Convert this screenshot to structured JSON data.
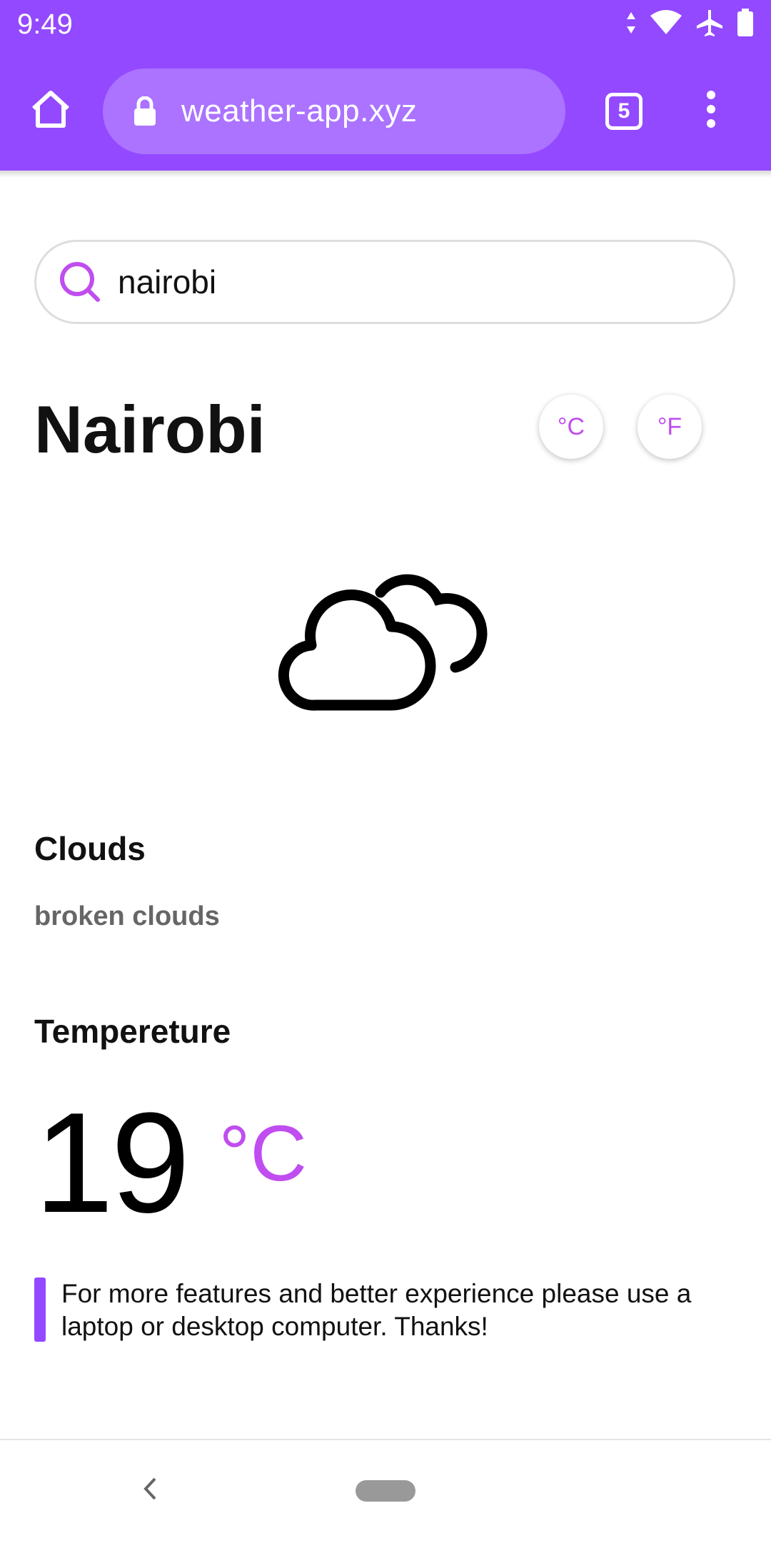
{
  "status_bar": {
    "time": "9:49",
    "icons": [
      "data-arrows-icon",
      "wifi-icon",
      "airplane-icon",
      "battery-icon"
    ]
  },
  "browser": {
    "url": "weather-app.xyz",
    "tab_count": "5",
    "icons": [
      "home-icon",
      "lock-icon",
      "more-vert-icon"
    ],
    "theme_color": "#9349FF",
    "urlbar_color": "#AB73FF"
  },
  "search": {
    "value": "nairobi",
    "icon": "search-icon"
  },
  "city": {
    "name": "Nairobi"
  },
  "units": {
    "celsius_label": "°C",
    "fahrenheit_label": "°F"
  },
  "weather": {
    "icon": "cloudy-icon",
    "section_title": "Clouds",
    "description": "broken clouds"
  },
  "temperature": {
    "section_title": "Tempereture",
    "value": "19",
    "unit": "°C",
    "accent_color": "#C04DF0"
  },
  "notice": {
    "text": "For more features and better experience please use a laptop or desktop computer. Thanks!"
  },
  "nav": {
    "icons": [
      "back-icon",
      "home-pill"
    ]
  }
}
